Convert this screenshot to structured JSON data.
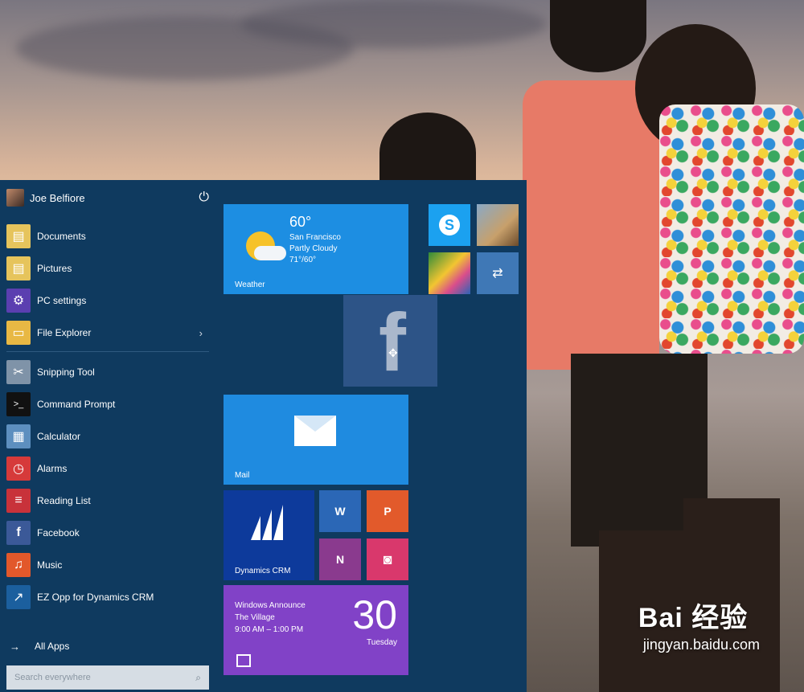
{
  "user": {
    "name": "Joe Belfiore"
  },
  "left_items": [
    {
      "label": "Documents"
    },
    {
      "label": "Pictures"
    },
    {
      "label": "PC settings"
    },
    {
      "label": "File Explorer",
      "has_submenu": true
    },
    {
      "label": "Snipping Tool"
    },
    {
      "label": "Command Prompt"
    },
    {
      "label": "Calculator"
    },
    {
      "label": "Alarms"
    },
    {
      "label": "Reading List"
    },
    {
      "label": "Facebook"
    },
    {
      "label": "Music"
    },
    {
      "label": "EZ Opp for  Dynamics CRM"
    }
  ],
  "all_apps": {
    "label": "All Apps"
  },
  "search": {
    "placeholder": "Search everywhere"
  },
  "tiles": {
    "weather": {
      "temp": "60°",
      "city": "San Francisco",
      "condition": "Partly Cloudy",
      "range": "71°/60°",
      "label": "Weather"
    },
    "facebook": {
      "glyph": "f"
    },
    "mail": {
      "label": "Mail"
    },
    "dynamics": {
      "label": "Dynamics CRM"
    },
    "word": {
      "glyph": "W"
    },
    "powerpoint": {
      "glyph": "P"
    },
    "onenote": {
      "glyph": "N"
    },
    "calendar": {
      "event": "Windows Announce",
      "location": "The Village",
      "time": "9:00 AM – 1:00 PM",
      "day": "30",
      "weekday": "Tuesday"
    }
  },
  "watermark": {
    "brand": "Bai 经验",
    "url": "jingyan.baidu.com"
  },
  "colors": {
    "start_bg": "#0f3a5f",
    "tile_blue": "#1d8ee2",
    "calendar_purple": "#8142c7"
  }
}
